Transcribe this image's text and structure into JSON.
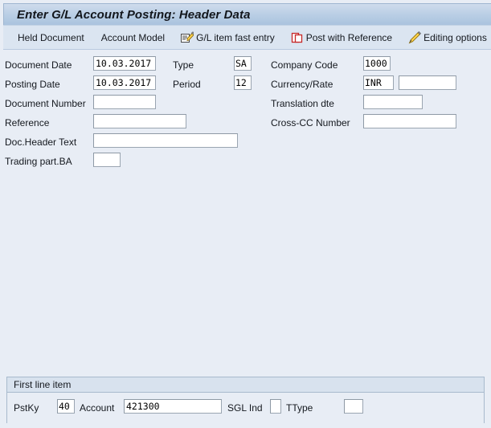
{
  "window": {
    "title": "Enter G/L Account Posting: Header Data"
  },
  "toolbar": {
    "items": [
      {
        "label": "Held Document",
        "icon": "none"
      },
      {
        "label": "Account Model",
        "icon": "none"
      },
      {
        "label": "G/L item fast entry",
        "icon": "fast-entry-icon"
      },
      {
        "label": "Post with Reference",
        "icon": "post-with-reference-icon"
      },
      {
        "label": "Editing options",
        "icon": "pencil-icon"
      }
    ]
  },
  "header_form": {
    "left_column": [
      {
        "label": "Document Date",
        "value": "10.03.2017"
      },
      {
        "label": "Posting Date",
        "value": "10.03.2017"
      },
      {
        "label": "Document Number",
        "value": ""
      },
      {
        "label": "Reference",
        "value": ""
      },
      {
        "label": "Doc.Header Text",
        "value": ""
      },
      {
        "label": "Trading part.BA",
        "value": ""
      }
    ],
    "middle_column": [
      {
        "label": "Type",
        "value": "SA"
      },
      {
        "label": "Period",
        "value": "12"
      }
    ],
    "right_column": [
      {
        "label": "Company Code",
        "value": "1000"
      },
      {
        "label": "Currency/Rate",
        "value": "INR",
        "value2": ""
      },
      {
        "label": "Translation dte",
        "value": ""
      },
      {
        "label": "Cross-CC Number",
        "value": ""
      }
    ]
  },
  "first_line_item": {
    "title": "First line item",
    "fields": [
      {
        "label": "PstKy",
        "value": "40"
      },
      {
        "label": "Account",
        "value": "421300"
      },
      {
        "label": "SGL Ind",
        "value": ""
      },
      {
        "label": "TType",
        "value": ""
      }
    ]
  },
  "colors": {
    "background": "#e8edf5",
    "titlebar": "#bcd0e6",
    "toolbar": "#dbe5f1",
    "field_border": "#9aa5b1",
    "groupbox_border": "#a8bacd"
  }
}
